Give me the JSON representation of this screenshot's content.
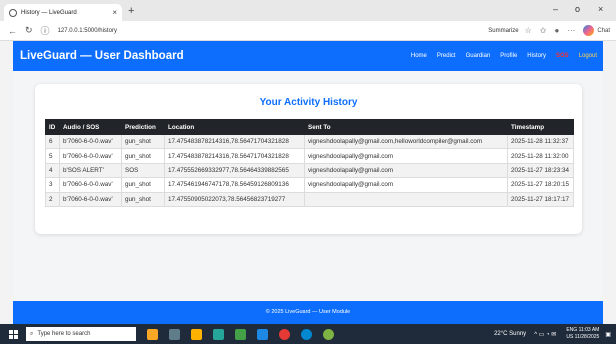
{
  "browser": {
    "tab_title": "History — LiveGuard",
    "url": "127.0.0.1:5000/history",
    "summarize": "Summarize",
    "chat": "Chat",
    "close_tab": "×",
    "new_tab": "+",
    "minimize": "–",
    "restore": "o",
    "close": "×"
  },
  "header": {
    "brand": "LiveGuard — User Dashboard",
    "nav": [
      "Home",
      "Predict",
      "Guardian",
      "Profile",
      "History"
    ],
    "sos": "SOS",
    "logout": "Logout"
  },
  "main": {
    "title": "Your Activity History",
    "columns": [
      "ID",
      "Audio / SOS",
      "Prediction",
      "Location",
      "Sent To",
      "Timestamp"
    ],
    "rows": [
      {
        "id": "6",
        "audio": "b'7060-6-0-0.wav'",
        "prediction": "gun_shot",
        "location": "17.475483878214316,78.56471704321828",
        "sent_to": "vigneshdoolapally@gmail.com,helloworldcompiler@gmail.com",
        "timestamp": "2025-11-28 11:32:37"
      },
      {
        "id": "5",
        "audio": "b'7060-6-0-0.wav'",
        "prediction": "gun_shot",
        "location": "17.475483878214316,78.56471704321828",
        "sent_to": "vigneshdoolapally@gmail.com",
        "timestamp": "2025-11-28 11:32:00"
      },
      {
        "id": "4",
        "audio": "b'SOS ALERT'",
        "prediction": "SOS",
        "location": "17.475552669332977,78.56464339882565",
        "sent_to": "vigneshdoolapally@gmail.com",
        "timestamp": "2025-11-27 18:23:34"
      },
      {
        "id": "3",
        "audio": "b'7060-6-0-0.wav'",
        "prediction": "gun_shot",
        "location": "17.475461946747178,78.56459126809136",
        "sent_to": "vigneshdoolapally@gmail.com",
        "timestamp": "2025-11-27 18:20:15"
      },
      {
        "id": "2",
        "audio": "b'7060-6-0-0.wav'",
        "prediction": "gun_shot",
        "location": "17.47550905022073,78.56456823719277",
        "sent_to": "",
        "timestamp": "2025-11-27 18:17:17"
      }
    ]
  },
  "footer": {
    "text": "© 2025 LiveGuard — User Module"
  },
  "taskbar": {
    "search_placeholder": "Type here to search",
    "weather": "22°C Sunny",
    "lang1": "ENG",
    "lang2": "US",
    "time": "11:03 AM",
    "date": "11/28/2025"
  },
  "colors": {
    "primary": "#0d6efd",
    "table_header": "#212529",
    "sos": "#ff2d2d",
    "logout": "#ffd54f"
  }
}
